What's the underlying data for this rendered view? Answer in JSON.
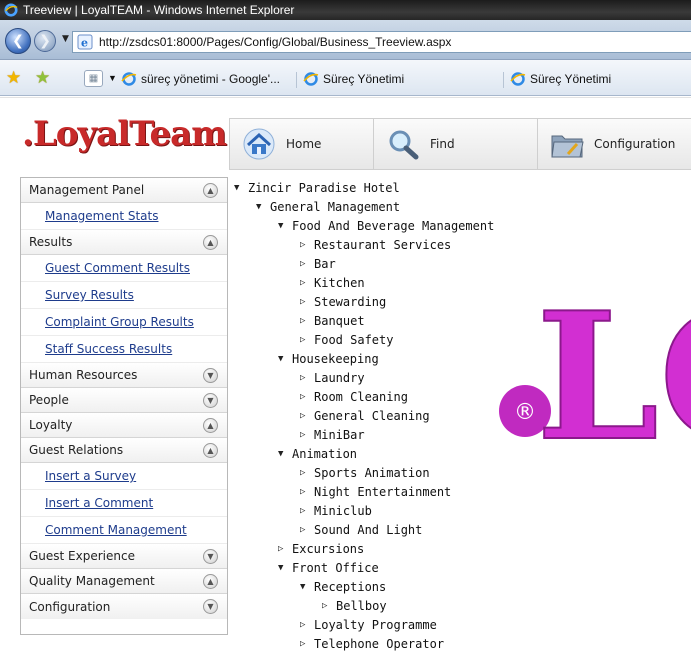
{
  "browser": {
    "window_title": "Treeview | LoyalTEAM - Windows Internet Explorer",
    "address": "http://zsdcs01:8000/Pages/Config/Global/Business_Treeview.aspx",
    "favorites": [
      {
        "label": "süreç yönetimi - Google'..."
      },
      {
        "label": "Süreç Yönetimi"
      },
      {
        "label": "Süreç Yönetimi"
      }
    ]
  },
  "header": {
    "logo_text": ".LoyalTeam",
    "logo_color": "#c82a2a",
    "tabs": [
      {
        "label": "Home",
        "icon": "home-icon"
      },
      {
        "label": "Find",
        "icon": "magnifier-icon"
      },
      {
        "label": "Configuration",
        "icon": "folder-config-icon"
      }
    ]
  },
  "sidebar": {
    "sections": [
      {
        "label": "Management Panel",
        "state": "expanded",
        "items": [
          "Management Stats"
        ]
      },
      {
        "label": "Results",
        "state": "expanded",
        "items": [
          "Guest Comment Results",
          "Survey Results",
          "Complaint Group Results",
          "Staff Success Results"
        ]
      },
      {
        "label": "Human Resources",
        "state": "collapsed",
        "items": []
      },
      {
        "label": "People",
        "state": "collapsed",
        "items": []
      },
      {
        "label": "Loyalty",
        "state": "expanded",
        "items": []
      },
      {
        "label": "Guest Relations",
        "state": "expanded",
        "items": [
          "Insert a Survey",
          "Insert a Comment",
          "Comment Management"
        ]
      },
      {
        "label": "Guest Experience",
        "state": "collapsed",
        "items": []
      },
      {
        "label": "Quality Management",
        "state": "expanded",
        "items": []
      },
      {
        "label": "Configuration",
        "state": "collapsed",
        "items": []
      }
    ]
  },
  "tree": {
    "nodes": [
      {
        "label": "Zincir Paradise Hotel",
        "level": 0,
        "expanded": true
      },
      {
        "label": "General Management",
        "level": 1,
        "expanded": true
      },
      {
        "label": "Food And Beverage Management",
        "level": 2,
        "expanded": true
      },
      {
        "label": "Restaurant Services",
        "level": 3,
        "expanded": false
      },
      {
        "label": "Bar",
        "level": 3,
        "expanded": false
      },
      {
        "label": "Kitchen",
        "level": 3,
        "expanded": false
      },
      {
        "label": "Stewarding",
        "level": 3,
        "expanded": false
      },
      {
        "label": "Banquet",
        "level": 3,
        "expanded": false
      },
      {
        "label": "Food Safety",
        "level": 3,
        "expanded": false
      },
      {
        "label": "Housekeeping",
        "level": 2,
        "expanded": true
      },
      {
        "label": "Laundry",
        "level": 3,
        "expanded": false
      },
      {
        "label": "Room Cleaning",
        "level": 3,
        "expanded": false
      },
      {
        "label": "General Cleaning",
        "level": 3,
        "expanded": false
      },
      {
        "label": "MiniBar",
        "level": 3,
        "expanded": false
      },
      {
        "label": "Animation",
        "level": 2,
        "expanded": true
      },
      {
        "label": "Sports Animation",
        "level": 3,
        "expanded": false
      },
      {
        "label": "Night Entertainment",
        "level": 3,
        "expanded": false
      },
      {
        "label": "Miniclub",
        "level": 3,
        "expanded": false
      },
      {
        "label": "Sound And Light",
        "level": 3,
        "expanded": false
      },
      {
        "label": "Excursions",
        "level": 2,
        "expanded": false
      },
      {
        "label": "Front Office",
        "level": 2,
        "expanded": true
      },
      {
        "label": "Receptions",
        "level": 3,
        "expanded": true
      },
      {
        "label": "Bellboy",
        "level": 4,
        "expanded": false
      },
      {
        "label": "Loyalty Programme",
        "level": 3,
        "expanded": false
      },
      {
        "label": "Telephone Operator",
        "level": 3,
        "expanded": false
      }
    ]
  },
  "watermark": {
    "text": "LO",
    "symbol": "®",
    "color": "#d22fd2"
  }
}
